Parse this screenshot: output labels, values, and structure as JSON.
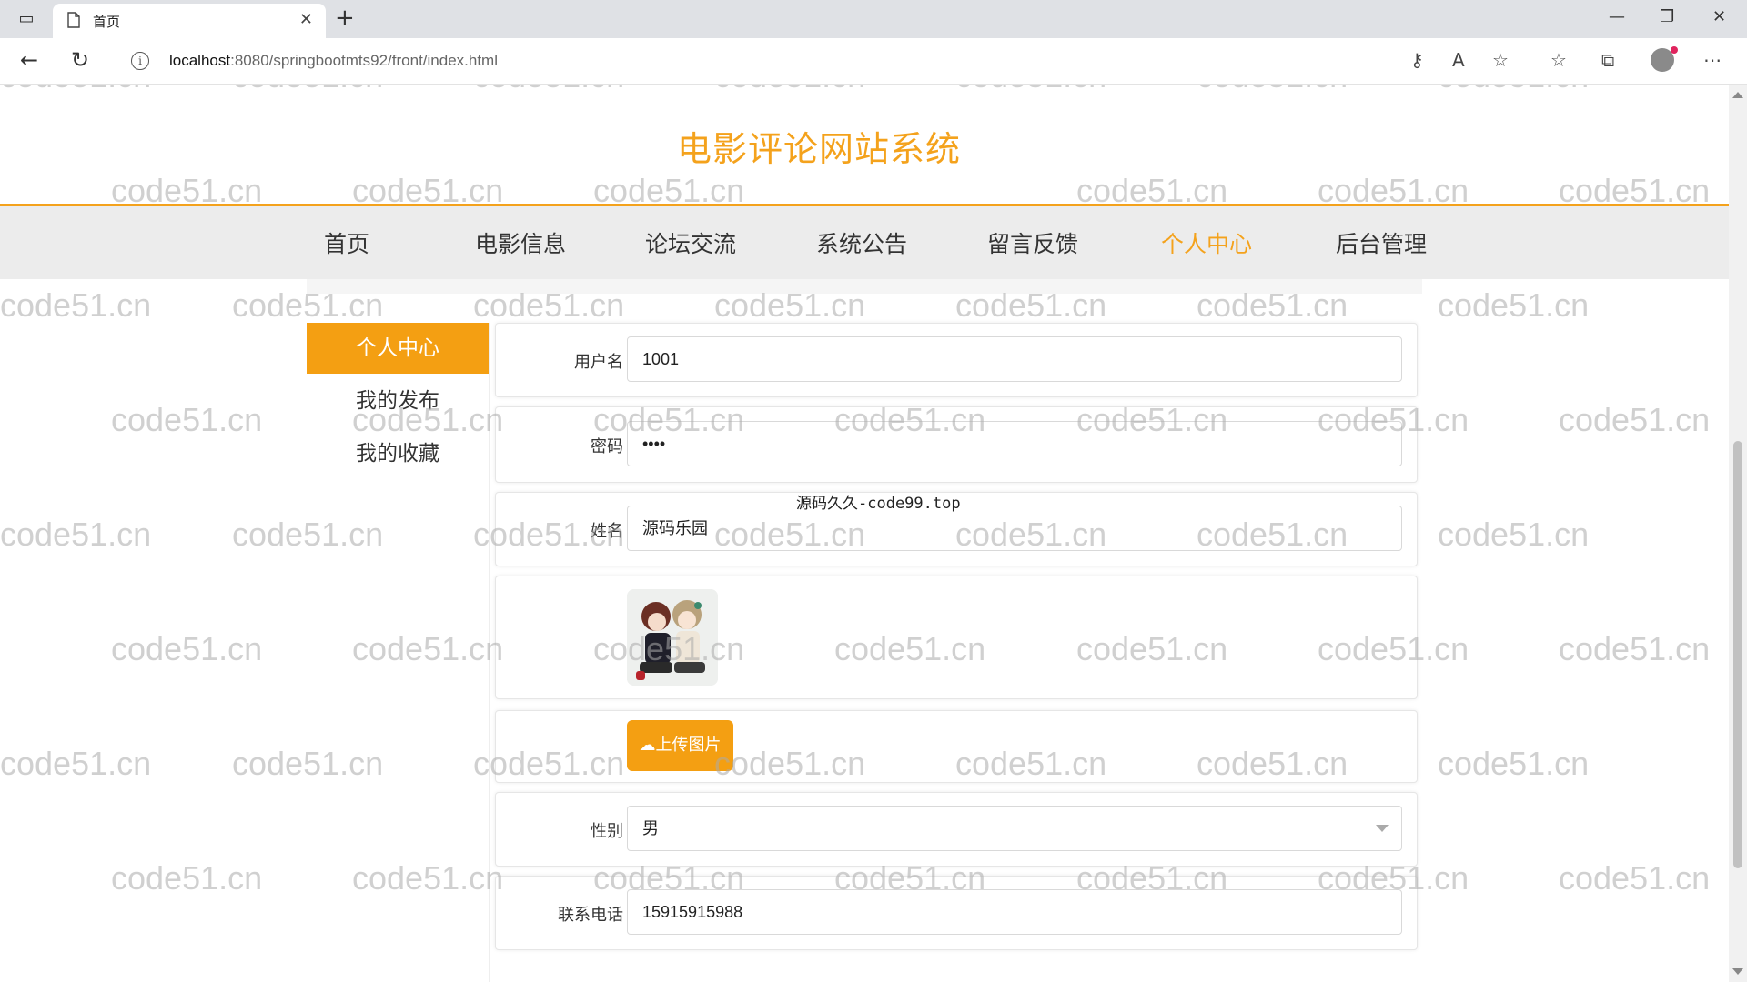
{
  "browser": {
    "tab_title": "首页",
    "url_host": "localhost",
    "url_rest": ":8080/springbootmts92/front/index.html"
  },
  "site": {
    "title": "电影评论网站系统",
    "accent_color": "#f4a21c"
  },
  "nav": {
    "items": [
      {
        "label": "首页"
      },
      {
        "label": "电影信息"
      },
      {
        "label": "论坛交流"
      },
      {
        "label": "系统公告"
      },
      {
        "label": "留言反馈"
      },
      {
        "label": "个人中心",
        "active": true
      },
      {
        "label": "后台管理"
      }
    ]
  },
  "sidebar": {
    "items": [
      {
        "label": "个人中心",
        "active": true
      },
      {
        "label": "我的发布"
      },
      {
        "label": "我的收藏"
      }
    ]
  },
  "form": {
    "username": {
      "label": "用户名",
      "value": "1001"
    },
    "password": {
      "label": "密码",
      "value": "••••"
    },
    "name": {
      "label": "姓名",
      "value": "源码乐园"
    },
    "upload_button": "上传图片",
    "gender": {
      "label": "性别",
      "value": "男"
    },
    "phone": {
      "label": "联系电话",
      "value": "15915915988"
    }
  },
  "overlay_note": "源码久久-code99.top",
  "watermark_text": "code51.cn"
}
